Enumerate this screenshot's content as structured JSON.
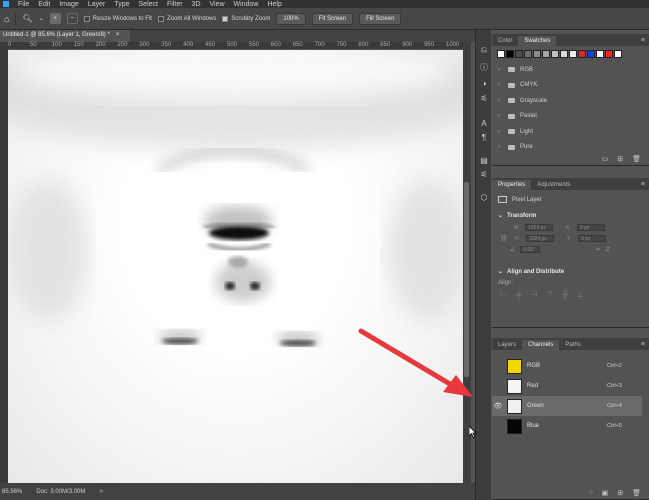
{
  "menu": [
    "File",
    "Edit",
    "Image",
    "Layer",
    "Type",
    "Select",
    "Filter",
    "3D",
    "View",
    "Window",
    "Help"
  ],
  "options": {
    "resize_windows": "Resize Windows to Fit",
    "zoom_all": "Zoom All Windows",
    "scrubby_zoom": "Scrubby Zoom",
    "zoom_value": "100%",
    "fit_screen": "Fit Screen",
    "fill_screen": "Fill Screen"
  },
  "document": {
    "tab_title": "Untitled-1 @ 85.6% (Layer 1, Green/8) *",
    "close": "×"
  },
  "ruler": {
    "ticks": [
      "0",
      "50",
      "100",
      "150",
      "200",
      "250",
      "300",
      "350",
      "400",
      "450",
      "500",
      "550",
      "600",
      "650",
      "700",
      "750",
      "800",
      "850",
      "900",
      "950",
      "1000"
    ]
  },
  "status": {
    "zoom": "85.56%",
    "doc": "Doc: 3.00M/3.00M",
    "arrow": ">"
  },
  "swatches_panel": {
    "tabs": [
      "Color",
      "Swatches"
    ],
    "active": "Swatches",
    "colors": [
      "#ffffff",
      "#000000",
      "#4d4d4d",
      "#6e6e6e",
      "#8c8c8c",
      "#a6a6a6",
      "#c0c0c0",
      "#d9d9d9",
      "#ececec",
      "#e3222a",
      "#1444e0",
      "#ffffff",
      "#ff2020",
      "#ffffff"
    ],
    "groups": [
      "RGB",
      "CMYK",
      "Grayscale",
      "Pastel",
      "Light",
      "Pure"
    ]
  },
  "properties_panel": {
    "tabs": [
      "Properties",
      "Adjustments"
    ],
    "active": "Properties",
    "layer_type": "Pixel Layer",
    "transform_title": "Transform",
    "w_label": "W",
    "w_value": "1024 px",
    "h_label": "H",
    "h_value": "1024 px",
    "x_label": "X",
    "x_value": "0 px",
    "y_label": "Y",
    "y_value": "0 px",
    "angle": "0.00°",
    "align_title": "Align and Distribute",
    "align_label": "Align:"
  },
  "channels_panel": {
    "tabs": [
      "Layers",
      "Channels",
      "Paths"
    ],
    "active": "Channels",
    "channels": [
      {
        "name": "RGB",
        "shortcut": "Ctrl+2",
        "thumb": "#f2d600",
        "visible": false,
        "selected": false
      },
      {
        "name": "Red",
        "shortcut": "Ctrl+3",
        "thumb": "#f4f4f4",
        "visible": false,
        "selected": false
      },
      {
        "name": "Green",
        "shortcut": "Ctrl+4",
        "thumb": "#f0f0f0",
        "visible": true,
        "selected": true
      },
      {
        "name": "Blue",
        "shortcut": "Ctrl+5",
        "thumb": "#050505",
        "visible": false,
        "selected": false
      }
    ]
  },
  "colors": {
    "annotation_arrow": "#e8383d",
    "ps_blue": "#31a8ff"
  }
}
